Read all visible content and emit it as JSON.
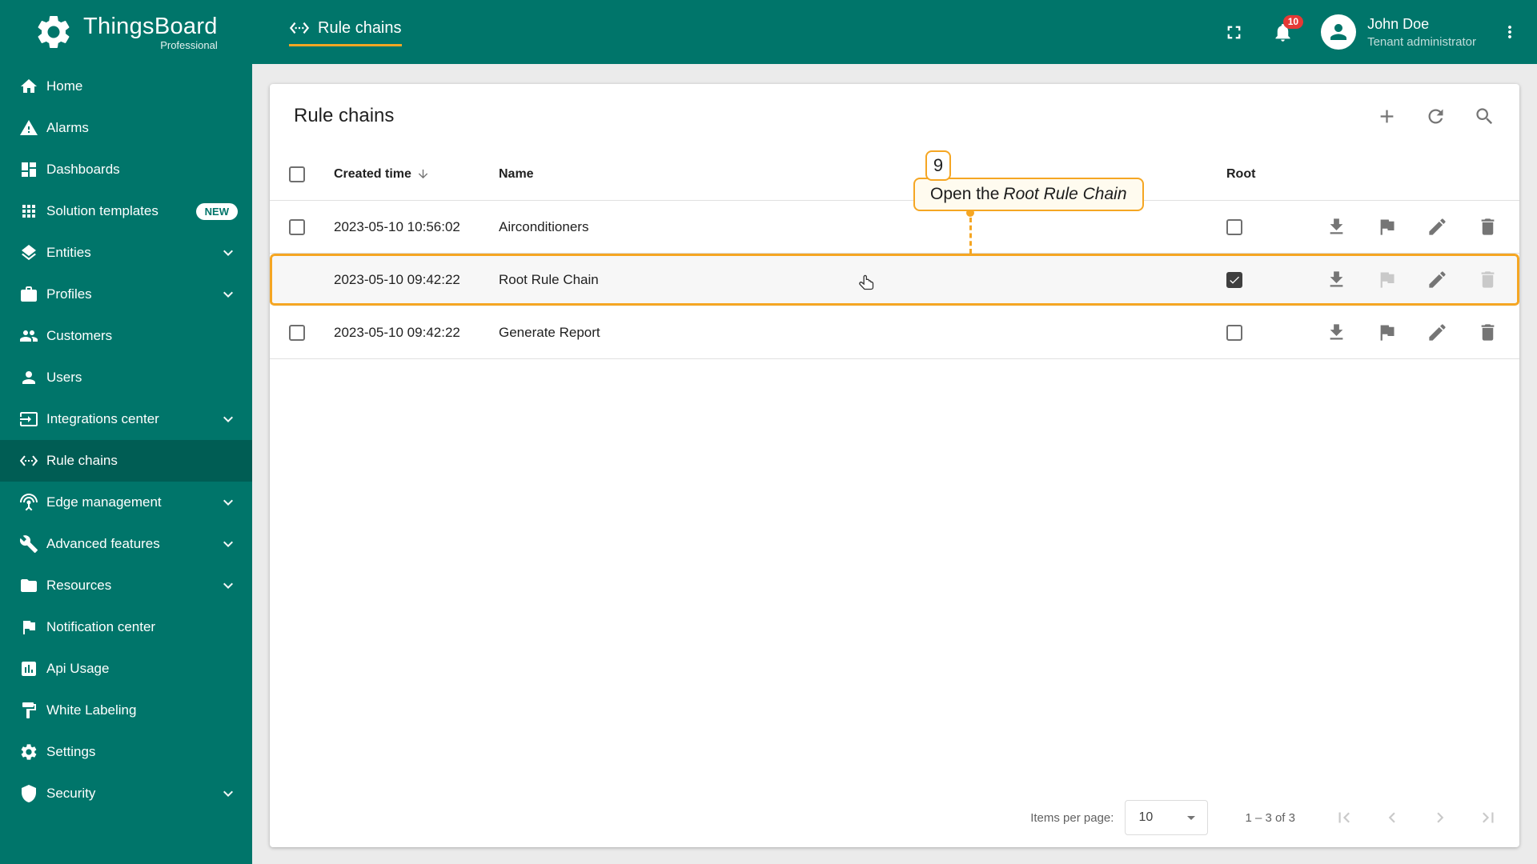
{
  "app": {
    "name": "ThingsBoard",
    "edition": "Professional"
  },
  "header": {
    "breadcrumb": "Rule chains",
    "notification_count": "10",
    "user": {
      "name": "John Doe",
      "role": "Tenant administrator"
    }
  },
  "sidebar": {
    "items": [
      {
        "label": "Home"
      },
      {
        "label": "Alarms"
      },
      {
        "label": "Dashboards"
      },
      {
        "label": "Solution templates",
        "badge": "NEW"
      },
      {
        "label": "Entities"
      },
      {
        "label": "Profiles"
      },
      {
        "label": "Customers"
      },
      {
        "label": "Users"
      },
      {
        "label": "Integrations center"
      },
      {
        "label": "Rule chains"
      },
      {
        "label": "Edge management"
      },
      {
        "label": "Advanced features"
      },
      {
        "label": "Resources"
      },
      {
        "label": "Notification center"
      },
      {
        "label": "Api Usage"
      },
      {
        "label": "White Labeling"
      },
      {
        "label": "Settings"
      },
      {
        "label": "Security"
      }
    ]
  },
  "page": {
    "title": "Rule chains",
    "table": {
      "headers": {
        "created": "Created time",
        "name": "Name",
        "root": "Root"
      },
      "rows": [
        {
          "created": "2023-05-10 10:56:02",
          "name": "Airconditioners",
          "root": false
        },
        {
          "created": "2023-05-10 09:42:22",
          "name": "Root Rule Chain",
          "root": true
        },
        {
          "created": "2023-05-10 09:42:22",
          "name": "Generate Report",
          "root": false
        }
      ]
    },
    "paginator": {
      "items_per_page_label": "Items per page:",
      "page_size": "10",
      "range": "1 – 3 of 3"
    }
  },
  "annotation": {
    "step": "9",
    "text": "Open the",
    "target": "Root Rule Chain"
  },
  "colors": {
    "primary": "#00756a",
    "accent": "#F5A623",
    "badge_red": "#E53935"
  }
}
